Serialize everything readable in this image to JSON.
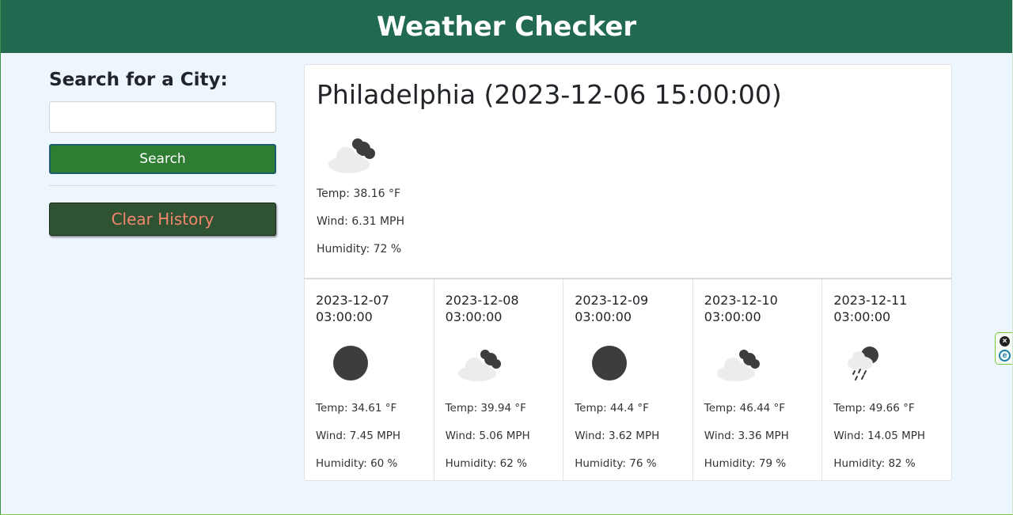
{
  "header": {
    "title": "Weather Checker"
  },
  "sidebar": {
    "heading": "Search for a City:",
    "search_value": "",
    "search_button": "Search",
    "clear_button": "Clear History"
  },
  "current": {
    "title": "Philadelphia (2023-12-06 15:00:00)",
    "icon": "cloudy-night-icon",
    "temp": "Temp: 38.16 °F",
    "wind": "Wind: 6.31 MPH",
    "humidity": "Humidity: 72 %"
  },
  "forecast": [
    {
      "date": "2023-12-07",
      "time": "03:00:00",
      "icon": "clear-night-icon",
      "temp": "Temp: 34.61 °F",
      "wind": "Wind: 7.45 MPH",
      "humidity": "Humidity: 60 %"
    },
    {
      "date": "2023-12-08",
      "time": "03:00:00",
      "icon": "cloudy-night-icon",
      "temp": "Temp: 39.94 °F",
      "wind": "Wind: 5.06 MPH",
      "humidity": "Humidity: 62 %"
    },
    {
      "date": "2023-12-09",
      "time": "03:00:00",
      "icon": "clear-night-icon",
      "temp": "Temp: 44.4 °F",
      "wind": "Wind: 3.62 MPH",
      "humidity": "Humidity: 76 %"
    },
    {
      "date": "2023-12-10",
      "time": "03:00:00",
      "icon": "cloudy-night-icon",
      "temp": "Temp: 46.44 °F",
      "wind": "Wind: 3.36 MPH",
      "humidity": "Humidity: 79 %"
    },
    {
      "date": "2023-12-11",
      "time": "03:00:00",
      "icon": "rain-night-icon",
      "temp": "Temp: 49.66 °F",
      "wind": "Wind: 14.05 MPH",
      "humidity": "Humidity: 82 %"
    }
  ],
  "colors": {
    "header_bg": "#216a50",
    "page_bg": "#eef6fd",
    "search_button_bg": "#2e7d32",
    "clear_button_bg": "#2f5232",
    "clear_button_text": "#f2876e"
  },
  "extension_widget": {
    "icons": [
      "close-icon",
      "extension-e-icon"
    ]
  }
}
